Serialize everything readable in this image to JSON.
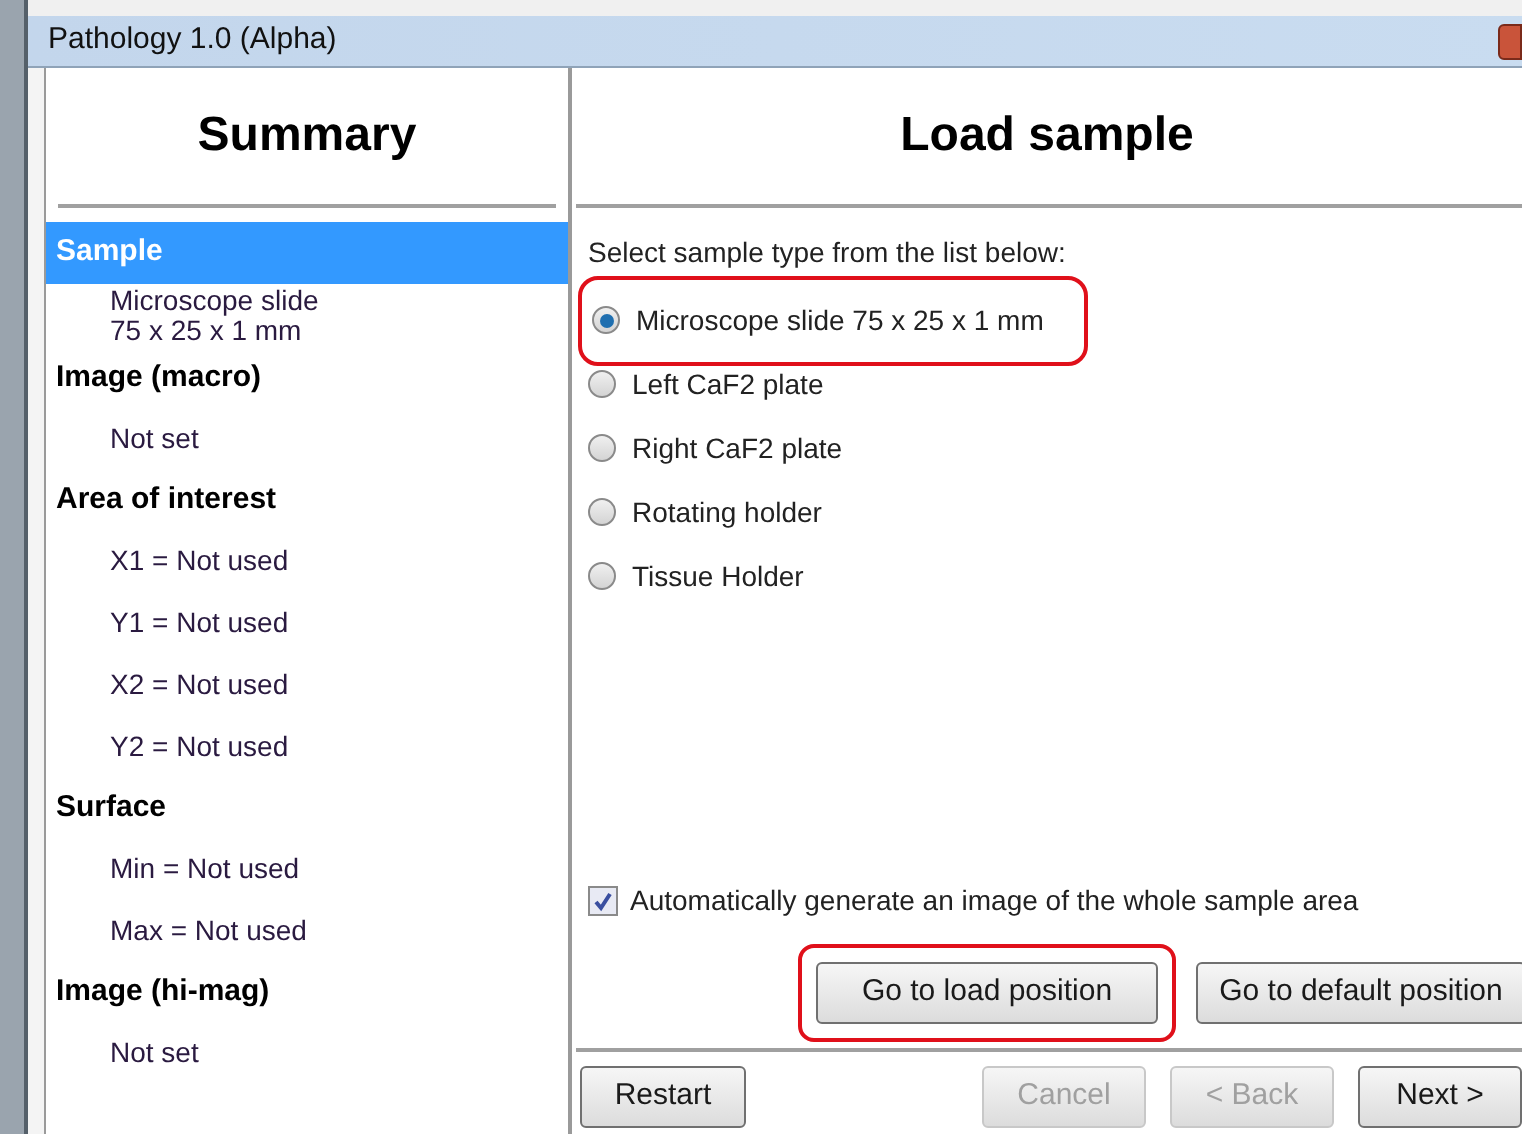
{
  "window": {
    "title": "Pathology 1.0 (Alpha)"
  },
  "summary": {
    "title": "Summary",
    "items": [
      {
        "kind": "header",
        "text": "Sample",
        "selected": true
      },
      {
        "kind": "value",
        "text": "Microscope slide\n75 x 25 x 1 mm"
      },
      {
        "kind": "header",
        "text": "Image (macro)",
        "selected": false
      },
      {
        "kind": "value",
        "text": "Not set"
      },
      {
        "kind": "header",
        "text": "Area of interest",
        "selected": false
      },
      {
        "kind": "value",
        "text": "X1 = Not used"
      },
      {
        "kind": "value",
        "text": "Y1 = Not used"
      },
      {
        "kind": "value",
        "text": "X2 = Not used"
      },
      {
        "kind": "value",
        "text": "Y2 = Not used"
      },
      {
        "kind": "header",
        "text": "Surface",
        "selected": false
      },
      {
        "kind": "value",
        "text": "Min = Not used"
      },
      {
        "kind": "value",
        "text": "Max = Not used"
      },
      {
        "kind": "header",
        "text": "Image (hi-mag)",
        "selected": false
      },
      {
        "kind": "value",
        "text": "Not set"
      }
    ]
  },
  "page": {
    "title": "Load sample",
    "prompt": "Select sample type from the list below:",
    "options": [
      {
        "label": "Microscope slide 75 x 25 x 1 mm",
        "selected": true,
        "highlighted": true
      },
      {
        "label": "Left CaF2 plate",
        "selected": false,
        "highlighted": false
      },
      {
        "label": "Right CaF2 plate",
        "selected": false,
        "highlighted": false
      },
      {
        "label": "Rotating holder",
        "selected": false,
        "highlighted": false
      },
      {
        "label": "Tissue Holder",
        "selected": false,
        "highlighted": false
      }
    ],
    "auto_image": {
      "label": "Automatically generate an image of the whole sample area",
      "checked": true
    },
    "position_buttons": [
      {
        "label": "Go to load position",
        "highlighted": true
      },
      {
        "label": "Go to default position",
        "highlighted": false
      }
    ]
  },
  "footer": {
    "restart": {
      "label": "Restart",
      "disabled": false
    },
    "nav": [
      {
        "label": "Cancel",
        "disabled": true
      },
      {
        "label": "< Back",
        "disabled": true
      },
      {
        "label": "Next >",
        "disabled": false
      }
    ]
  }
}
